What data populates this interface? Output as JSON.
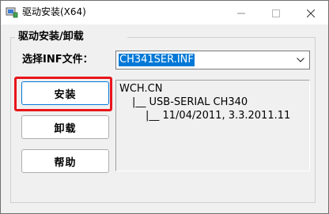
{
  "window": {
    "title": "驱动安装(X64)"
  },
  "group": {
    "label": "驱动安装/卸载"
  },
  "inf": {
    "label": "选择INF文件：",
    "selected": "CH341SER.INF"
  },
  "buttons": {
    "install": "安装",
    "uninstall": "卸载",
    "help": "帮助"
  },
  "info": {
    "lines": [
      "WCH.CN",
      "|__ USB-SERIAL CH340",
      "|__ 11/04/2011, 3.3.2011.11"
    ]
  },
  "colors": {
    "selection": "#0078d7",
    "highlight": "#e8151b"
  },
  "icons": {
    "app": "usb-driver-icon",
    "minimize": "minimize-icon",
    "maximize": "maximize-icon",
    "close": "close-icon",
    "dropdown": "chevron-down-icon"
  }
}
